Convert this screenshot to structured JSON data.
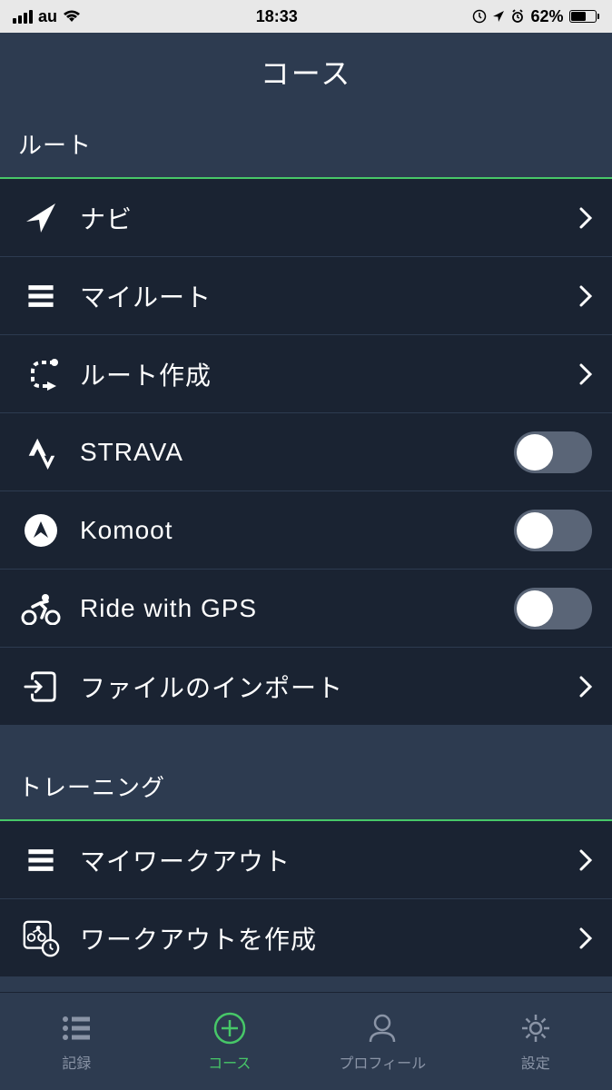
{
  "status": {
    "carrier": "au",
    "time": "18:33",
    "battery": "62%"
  },
  "header": {
    "title": "コース"
  },
  "sections": {
    "route": {
      "title": "ルート",
      "items": {
        "navi": "ナビ",
        "myroute": "マイルート",
        "create": "ルート作成",
        "strava": "STRAVA",
        "komoot": "Komoot",
        "rwgps": "Ride with GPS",
        "import": "ファイルのインポート"
      }
    },
    "training": {
      "title": "トレーニング",
      "items": {
        "myworkout": "マイワークアウト",
        "create": "ワークアウトを作成"
      }
    }
  },
  "tabs": {
    "record": "記録",
    "course": "コース",
    "profile": "プロフィール",
    "settings": "設定"
  }
}
